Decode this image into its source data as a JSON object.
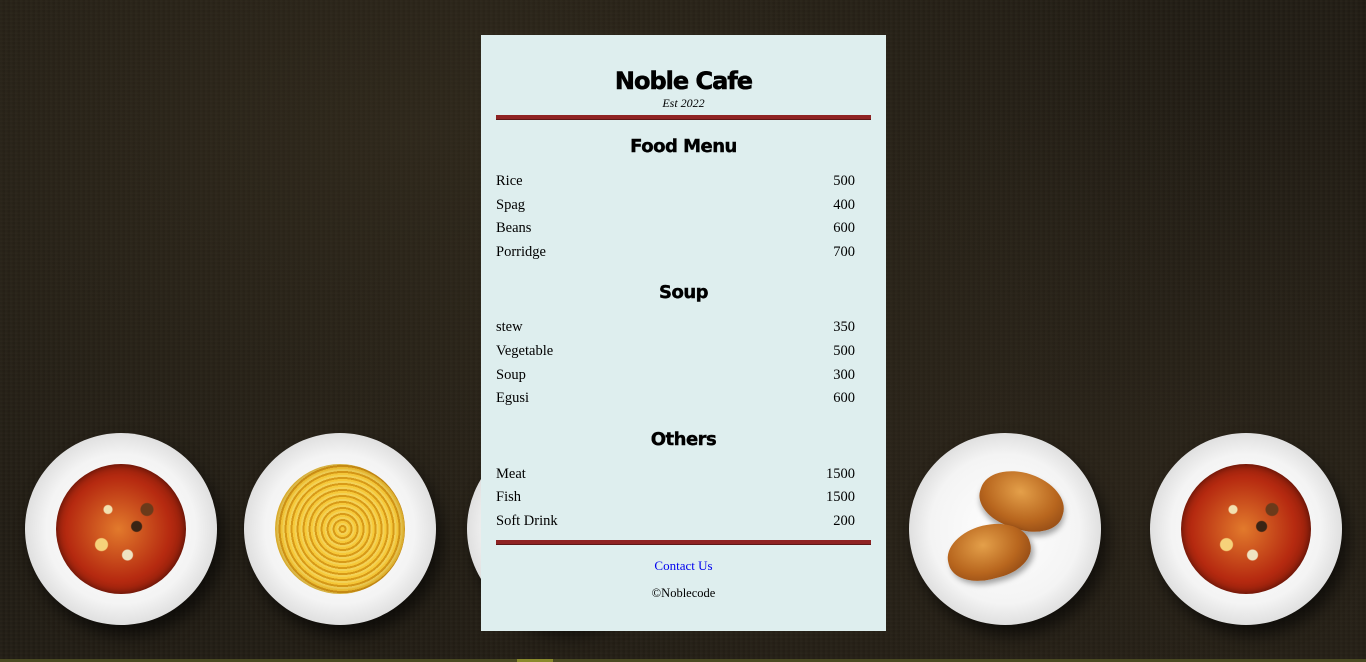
{
  "cafe": {
    "name": "Noble Cafe",
    "established": "Est 2022"
  },
  "sections": [
    {
      "title": "Food Menu",
      "items": [
        {
          "name": "Rice",
          "price": "500"
        },
        {
          "name": "Spag",
          "price": "400"
        },
        {
          "name": "Beans",
          "price": "600"
        },
        {
          "name": "Porridge",
          "price": "700"
        }
      ]
    },
    {
      "title": "Soup",
      "items": [
        {
          "name": "stew",
          "price": "350"
        },
        {
          "name": "Vegetable",
          "price": "500"
        },
        {
          "name": "Soup",
          "price": "300"
        },
        {
          "name": "Egusi",
          "price": "600"
        }
      ]
    },
    {
      "title": "Others",
      "items": [
        {
          "name": "Meat",
          "price": "1500"
        },
        {
          "name": "Fish",
          "price": "1500"
        },
        {
          "name": "Soft Drink",
          "price": "200"
        }
      ]
    }
  ],
  "footer": {
    "contact_label": "Contact Us",
    "copyright": "©Noblecode"
  },
  "colors": {
    "card_background": "#deeeee",
    "rule": "#8f2323",
    "page_background": "#221d14",
    "link": "#0000ee"
  },
  "decor": {
    "plates": [
      "soup-plate",
      "spaghetti-plate",
      "hidden-plate",
      "croissant-plate",
      "soup-plate"
    ]
  }
}
